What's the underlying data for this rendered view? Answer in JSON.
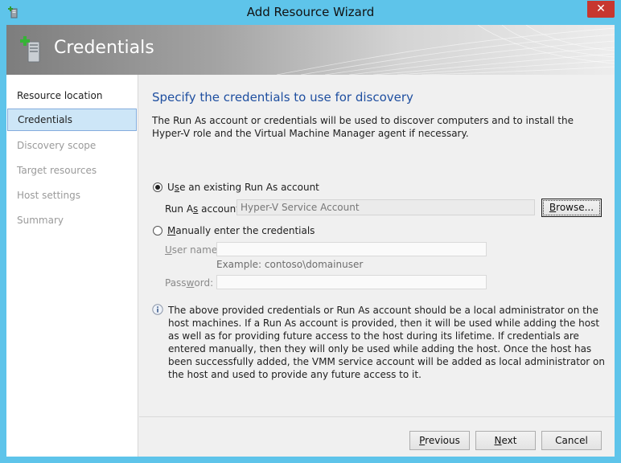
{
  "window": {
    "title": "Add Resource Wizard",
    "close_glyph": "✕"
  },
  "banner": {
    "title": "Credentials",
    "icon": "server-add-icon"
  },
  "nav": {
    "items": [
      {
        "label": "Resource location",
        "state": "done"
      },
      {
        "label": "Credentials",
        "state": "active"
      },
      {
        "label": "Discovery scope",
        "state": "pending"
      },
      {
        "label": "Target resources",
        "state": "pending"
      },
      {
        "label": "Host settings",
        "state": "pending"
      },
      {
        "label": "Summary",
        "state": "pending"
      }
    ]
  },
  "main": {
    "heading": "Specify the credentials to use for discovery",
    "description": "The Run As account or credentials will be used to discover computers and to install the Hyper-V role and the Virtual Machine Manager agent if necessary.",
    "option_existing": {
      "pre": "U",
      "accel": "s",
      "post": "e an existing Run As account",
      "checked": true
    },
    "runas_label": {
      "pre": "Run A",
      "accel": "s",
      "post": " account:"
    },
    "runas_value": "Hyper-V Service Account",
    "browse": {
      "accel": "B",
      "post": "rowse..."
    },
    "option_manual": {
      "accel": "M",
      "post": "anually enter the credentials",
      "checked": false
    },
    "username_label": {
      "accel": "U",
      "post": "ser name:"
    },
    "username_value": "",
    "username_example": "Example: contoso\\domainuser",
    "password_label": {
      "pre": "Pass",
      "accel": "w",
      "post": "ord:"
    },
    "password_value": "",
    "info": "The above provided credentials or Run As account should be a local administrator on the host machines. If a Run As account is provided, then it will be used while adding the host as well as for providing future access to the host during its lifetime. If credentials are entered manually, then they will only be used while adding the host. Once the host has been successfully added, the VMM service account will be added as local administrator on the host and used to provide any future access to it."
  },
  "footer": {
    "previous": {
      "accel": "P",
      "post": "revious"
    },
    "next": {
      "accel": "N",
      "post": "ext"
    },
    "cancel": "Cancel"
  },
  "colors": {
    "accent": "#1f4fa0",
    "frame": "#5ec4ea",
    "close": "#c7372f",
    "selection": "#cde6f7"
  }
}
